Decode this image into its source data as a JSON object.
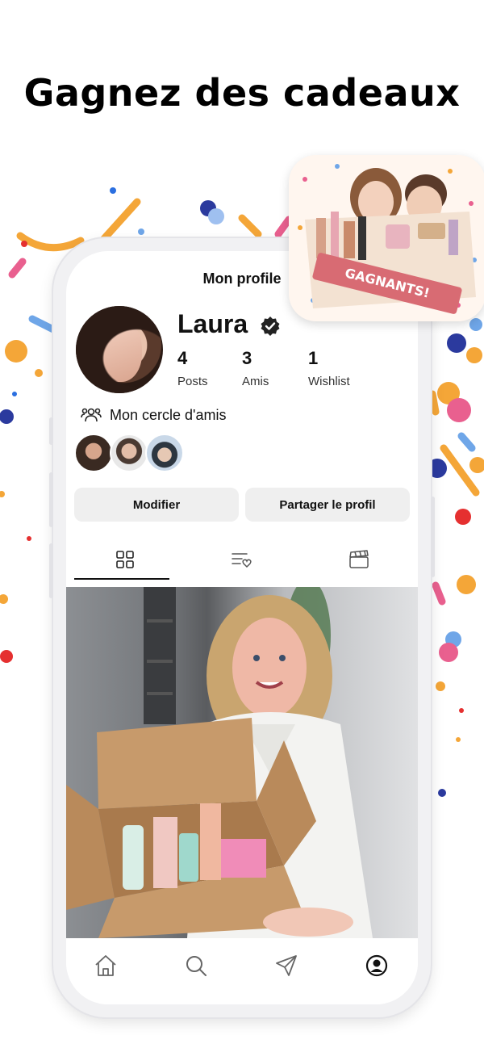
{
  "headline": "Gagnez des cadeaux",
  "screen": {
    "title": "Mon profile",
    "user_name": "Laura",
    "stats": [
      {
        "value": "4",
        "label": "Posts"
      },
      {
        "value": "3",
        "label": "Amis"
      },
      {
        "value": "1",
        "label": "Wishlist"
      }
    ],
    "circle_label": "Mon cercle d'amis",
    "buttons": {
      "edit": "Modifier",
      "share": "Partager le profil"
    }
  },
  "promo": {
    "ribbon": "GAGNANTS!"
  },
  "icons": {
    "verified": "verified-badge-icon",
    "people": "people-group-icon",
    "grid": "grid-icon",
    "wishlist": "wishlist-icon",
    "clapper": "clapperboard-icon",
    "home": "home-icon",
    "search": "search-icon",
    "send": "send-icon",
    "profile": "profile-icon"
  },
  "colors": {
    "accent_orange": "#f4a638",
    "accent_blue": "#2b3a9e",
    "accent_pink": "#e9608f",
    "accent_red": "#e53030",
    "ribbon": "#d86b73"
  }
}
